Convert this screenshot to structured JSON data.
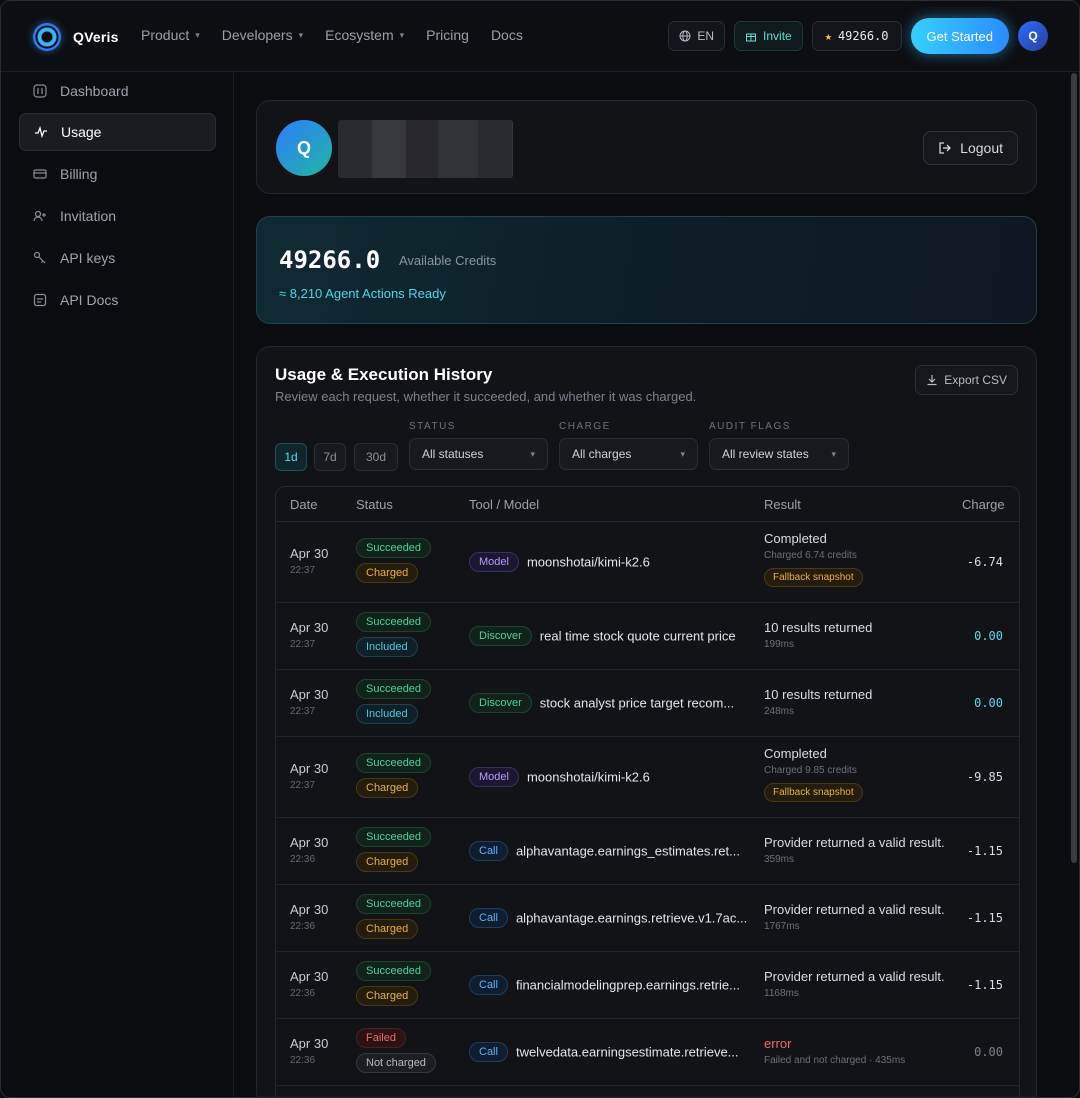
{
  "nav": {
    "brand": "QVeris",
    "links": [
      {
        "label": "Product",
        "dropdown": true
      },
      {
        "label": "Developers",
        "dropdown": true
      },
      {
        "label": "Ecosystem",
        "dropdown": true
      },
      {
        "label": "Pricing",
        "dropdown": false
      },
      {
        "label": "Docs",
        "dropdown": false
      }
    ],
    "lang": "EN",
    "invite": "Invite",
    "credits": "49266.0",
    "cta": "Get Started",
    "avatar_initial": "Q"
  },
  "sidebar": {
    "items": [
      {
        "label": "Dashboard",
        "icon": "dashboard-icon",
        "active": false
      },
      {
        "label": "Usage",
        "icon": "activity-icon",
        "active": true
      },
      {
        "label": "Billing",
        "icon": "card-icon",
        "active": false
      },
      {
        "label": "Invitation",
        "icon": "user-plus-icon",
        "active": false
      },
      {
        "label": "API keys",
        "icon": "key-icon",
        "active": false
      },
      {
        "label": "API Docs",
        "icon": "doc-icon",
        "active": false
      }
    ]
  },
  "profile": {
    "avatar_initial": "Q",
    "logout": "Logout"
  },
  "credits": {
    "amount": "49266.0",
    "label": "Available Credits",
    "actions": "≈ 8,210 Agent Actions Ready"
  },
  "history": {
    "title": "Usage & Execution History",
    "subtitle": "Review each request, whether it succeeded, and whether it was charged.",
    "export": "Export CSV",
    "ranges": [
      {
        "label": "1d",
        "active": true
      },
      {
        "label": "7d",
        "active": false
      },
      {
        "label": "30d",
        "active": false
      }
    ],
    "filters": {
      "status": {
        "label": "STATUS",
        "value": "All statuses"
      },
      "charge": {
        "label": "CHARGE",
        "value": "All charges"
      },
      "audit": {
        "label": "AUDIT FLAGS",
        "value": "All review states"
      }
    },
    "columns": {
      "date": "Date",
      "status": "Status",
      "tool": "Tool / Model",
      "result": "Result",
      "charge": "Charge"
    },
    "rows": [
      {
        "date": "Apr 30",
        "time": "22:37",
        "status": "Succeeded",
        "charge_state": "Charged",
        "tag": "Model",
        "tool": "moonshotai/kimi-k2.6",
        "result": "Completed",
        "result_sub": "Charged 6.74 credits",
        "flag": "Fallback snapshot",
        "charge": "-6.74"
      },
      {
        "date": "Apr 30",
        "time": "22:37",
        "status": "Succeeded",
        "charge_state": "Included",
        "tag": "Discover",
        "tool": "real time stock quote current price",
        "result": "10 results returned",
        "result_sub": "199ms",
        "flag": "",
        "charge": "0.00"
      },
      {
        "date": "Apr 30",
        "time": "22:37",
        "status": "Succeeded",
        "charge_state": "Included",
        "tag": "Discover",
        "tool": "stock analyst price target recom...",
        "result": "10 results returned",
        "result_sub": "248ms",
        "flag": "",
        "charge": "0.00"
      },
      {
        "date": "Apr 30",
        "time": "22:37",
        "status": "Succeeded",
        "charge_state": "Charged",
        "tag": "Model",
        "tool": "moonshotai/kimi-k2.6",
        "result": "Completed",
        "result_sub": "Charged 9.85 credits",
        "flag": "Fallback snapshot",
        "charge": "-9.85"
      },
      {
        "date": "Apr 30",
        "time": "22:36",
        "status": "Succeeded",
        "charge_state": "Charged",
        "tag": "Call",
        "tool": "alphavantage.earnings_estimates.ret...",
        "result": "Provider returned a valid result.",
        "result_sub": "359ms",
        "flag": "",
        "charge": "-1.15"
      },
      {
        "date": "Apr 30",
        "time": "22:36",
        "status": "Succeeded",
        "charge_state": "Charged",
        "tag": "Call",
        "tool": "alphavantage.earnings.retrieve.v1.7ac...",
        "result": "Provider returned a valid result.",
        "result_sub": "1767ms",
        "flag": "",
        "charge": "-1.15"
      },
      {
        "date": "Apr 30",
        "time": "22:36",
        "status": "Succeeded",
        "charge_state": "Charged",
        "tag": "Call",
        "tool": "financialmodelingprep.earnings.retrie...",
        "result": "Provider returned a valid result.",
        "result_sub": "1168ms",
        "flag": "",
        "charge": "-1.15"
      },
      {
        "date": "Apr 30",
        "time": "22:36",
        "status": "Failed",
        "charge_state": "Not charged",
        "tag": "Call",
        "tool": "twelvedata.earningsestimate.retrieve...",
        "result": "error",
        "result_sub": "Failed and not charged · 435ms",
        "flag": "",
        "charge": "0.00"
      }
    ]
  }
}
